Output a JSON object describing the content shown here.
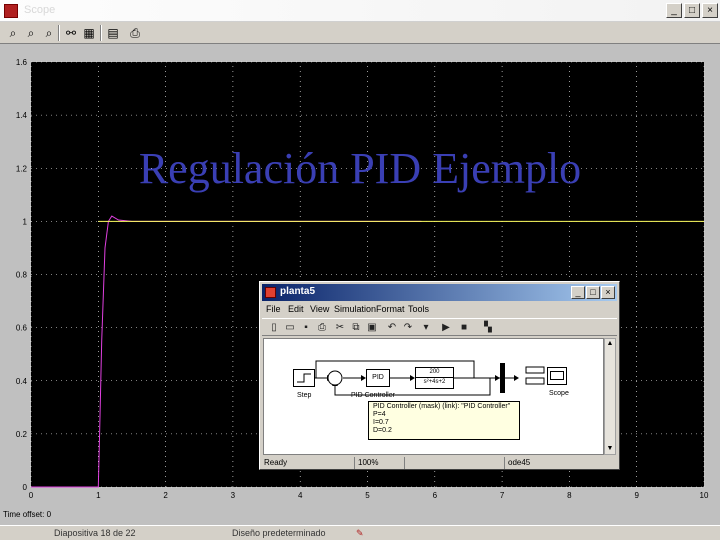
{
  "window": {
    "title": "Scope"
  },
  "toolbar": {
    "icons": [
      "zoom-in-icon",
      "zoom-x-icon",
      "zoom-y-icon",
      "binoculars-icon",
      "save-axes-icon",
      "params-icon",
      "print-icon"
    ]
  },
  "plot": {
    "yticks": [
      "0",
      "0.2",
      "0.4",
      "0.6",
      "0.8",
      "1",
      "1.2",
      "1.4",
      "1.6"
    ],
    "xticks": [
      "0",
      "1",
      "2",
      "3",
      "4",
      "5",
      "6",
      "7",
      "8",
      "9",
      "10"
    ],
    "time_offset_label": "Time offset:",
    "time_offset_value": "0",
    "colors": {
      "background": "#000000",
      "grid": "#ffffff",
      "response": "#e040e0",
      "setpoint": "#ffff60"
    }
  },
  "chart_data": {
    "type": "line",
    "xlim": [
      0,
      10
    ],
    "ylim": [
      0,
      1.6
    ],
    "series": [
      {
        "x": [
          0,
          1,
          1.02,
          1.05,
          1.1,
          1.15,
          1.2,
          1.3,
          1.5,
          2.0,
          3.0,
          5.8
        ],
        "values": [
          0,
          0,
          0.2,
          0.55,
          0.9,
          1.0,
          1.02,
          1.005,
          1.0,
          1.0,
          1.0,
          1.0
        ]
      },
      {
        "x": [
          1,
          10
        ],
        "values": [
          1,
          1
        ]
      }
    ]
  },
  "overlay": {
    "title": "Regulación PID Ejemplo"
  },
  "simulink": {
    "title": "planta5",
    "menu": [
      "File",
      "Edit",
      "View",
      "Simulation",
      "Format",
      "Tools"
    ],
    "blocks": {
      "step_label": "Step",
      "pid_text": "PID",
      "pid_label": "PID Controller",
      "tf_numerator": "200",
      "tf_denominator": "s²+4s+2",
      "scope_label": "Scope"
    },
    "tooltip": {
      "title": "PID Controller (mask) (link): \"PID Controller\"",
      "lines": [
        "P=4",
        "I=0.7",
        "D=0.2"
      ]
    },
    "status": {
      "ready": "Ready",
      "zoom": "100%",
      "solver": "ode45"
    }
  },
  "statusbar": {
    "slide": "Diapositiva 18 de 22",
    "design": "Diseño predeterminado"
  }
}
